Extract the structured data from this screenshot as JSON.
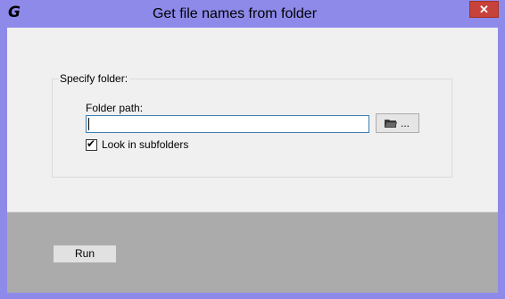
{
  "window": {
    "app_icon_letter": "G",
    "title": "Get file names from folder",
    "close_glyph": "✕"
  },
  "group": {
    "legend": "Specify folder:",
    "folder_path_label": "Folder path:",
    "folder_path_value": "",
    "browse_label": "...",
    "browse_icon": "folder-icon",
    "subfolders_label": "Look in subfolders",
    "subfolders_checked": true
  },
  "actions": {
    "run_label": "Run"
  },
  "colors": {
    "titlebar": "#8e8aea",
    "close": "#c7423a",
    "client": "#f0f0f0",
    "bottom_panel": "#ababab",
    "input_border": "#3c7fb1"
  }
}
